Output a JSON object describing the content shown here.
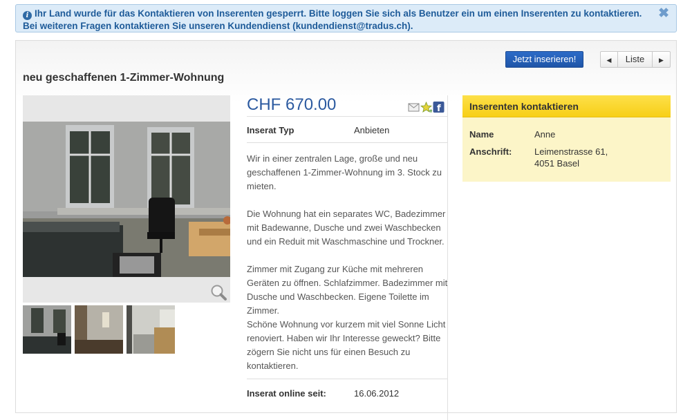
{
  "alert": {
    "text": "Ihr Land wurde für das Kontaktieren von Inserenten gesperrt. Bitte loggen Sie sich als Benutzer ein um einen Inserenten zu kontaktieren. Bei weiteren Fragen kontaktieren Sie unseren Kundendienst (kundendienst@tradus.ch).",
    "icon": "info-icon",
    "close_icon": "close-icon"
  },
  "toolbar": {
    "publish_label": "Jetzt inserieren!",
    "list_label": "Liste"
  },
  "listing": {
    "title": "neu geschaffenen 1-Zimmer-Wohnung",
    "price": "CHF 670.00",
    "type_label": "Inserat Typ",
    "type_value": "Anbieten",
    "description": [
      "Wir in einer zentralen Lage, große und neu geschaffenen 1-Zimmer-Wohnung im 3. Stock zu mieten.",
      "Die Wohnung hat ein separates WC, Badezimmer mit Badewanne, Dusche und zwei Waschbecken und ein Reduit mit Waschmaschine und Trockner.",
      "Zimmer mit Zugang zur Küche mit mehreren Geräten zu öffnen. Schlafzimmer. Badezimmer mit Dusche und Waschbecken. Eigene Toilette im Zimmer.",
      "Schöne Wohnung vor kurzem mit viel Sonne Licht renoviert. Haben wir Ihr Interesse geweckt? Bitte zögern Sie nicht uns für einen Besuch zu kontaktieren."
    ],
    "online_label": "Inserat online seit:",
    "online_value": "16.06.2012"
  },
  "contact": {
    "heading": "Inserenten kontaktieren",
    "name_label": "Name",
    "name_value": "Anne",
    "address_label": "Anschrift:",
    "address_line1": "Leimenstrasse 61,",
    "address_line2": "4051 Basel"
  },
  "colors": {
    "accent": "#2c5aa0",
    "contact_header": "#f7cf17",
    "alert_bg": "#dcebf8"
  }
}
